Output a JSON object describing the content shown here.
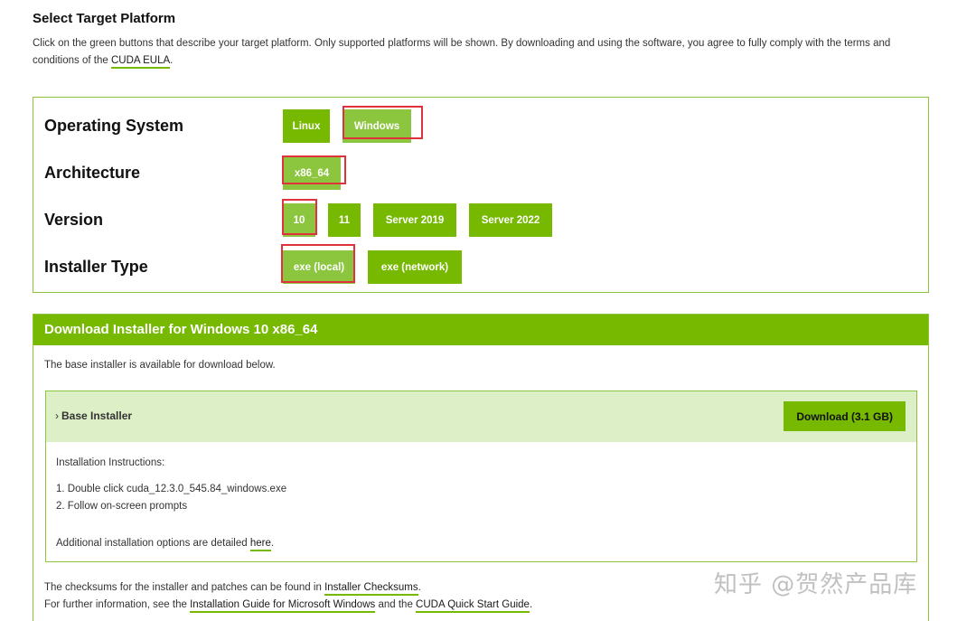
{
  "header": {
    "title": "Select Target Platform",
    "intro_text": "Click on the green buttons that describe your target platform. Only supported platforms will be shown. By downloading and using the software, you agree to fully comply with the terms and conditions of the",
    "eula_link": "CUDA EULA",
    "intro_end": "."
  },
  "selector": {
    "os_label": "Operating System",
    "os_options": [
      "Linux",
      "Windows"
    ],
    "arch_label": "Architecture",
    "arch_options": [
      "x86_64"
    ],
    "version_label": "Version",
    "version_options": [
      "10",
      "11",
      "Server 2019",
      "Server 2022"
    ],
    "installer_label": "Installer Type",
    "installer_options": [
      "exe (local)",
      "exe (network)"
    ]
  },
  "download": {
    "header": "Download Installer for Windows 10 x86_64",
    "note": "The base installer is available for download below.",
    "installer_title": "Base Installer",
    "download_button": "Download (3.1 GB)",
    "instructions_title": "Installation Instructions:",
    "step1": "1. Double click cuda_12.3.0_545.84_windows.exe",
    "step2": "2. Follow on-screen prompts",
    "additional_text": "Additional installation options are detailed",
    "here_link": "here",
    "period": "."
  },
  "footer": {
    "checksums_text": "The checksums for the installer and patches can be found in",
    "checksums_link": "Installer Checksums",
    "further_text": "For further information, see the",
    "install_guide_link": "Installation Guide for Microsoft Windows",
    "and_text": "and the",
    "quickstart_link": "CUDA Quick Start Guide",
    "period": "."
  },
  "watermark": "知乎 @贺然产品库",
  "colors": {
    "accent": "#76b900",
    "selected": "#8cc63f",
    "highlight": "#e0323c",
    "panel": "#dcefc6"
  }
}
